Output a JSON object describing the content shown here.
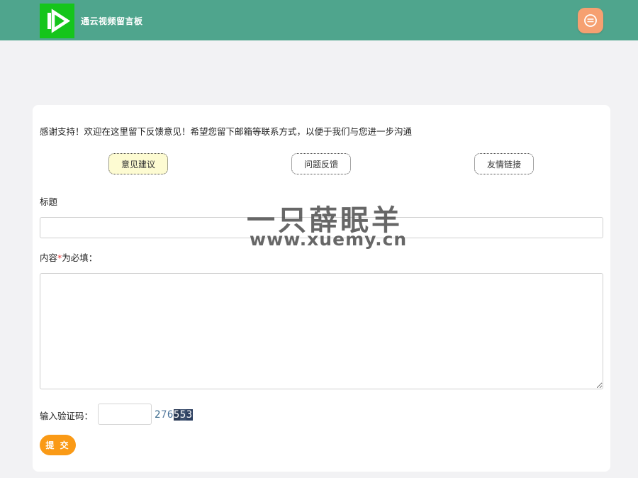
{
  "header": {
    "site_title": "通云视频留言板",
    "logo_icon": "play-logo-icon",
    "message_icon": "chat-bubble-icon",
    "bg_color": "#4fa58d",
    "logo_color": "#15c51b",
    "message_button_color": "#f6a071"
  },
  "form": {
    "intro": "感谢支持！欢迎在这里留下反馈意见！希望您留下邮箱等联系方式，以便于我们与您进一步沟通",
    "tabs": [
      {
        "label": "意见建议",
        "active": true
      },
      {
        "label": "问题反馈",
        "active": false
      },
      {
        "label": "友情链接",
        "active": false
      }
    ],
    "title_label": "标题",
    "title_value": "",
    "content_label_prefix": "内容",
    "content_required_mark": "*",
    "content_label_suffix": "为必填：",
    "content_value": "",
    "captcha_label": "输入验证码：",
    "captcha_value": "",
    "captcha_chars": [
      "2",
      "7",
      "6",
      "5",
      "5",
      "3"
    ],
    "submit_label": "提 交",
    "submit_color": "#fa9a16"
  },
  "watermark": {
    "title": "一只薛眠羊",
    "url": "www.xuemy.cn"
  }
}
